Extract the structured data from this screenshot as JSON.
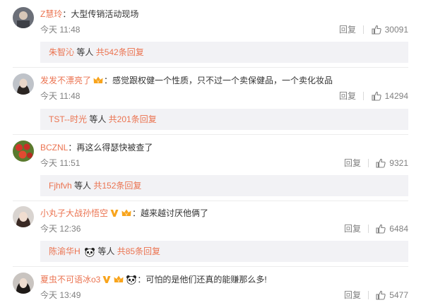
{
  "comments": [
    {
      "user": "Z慧玲",
      "text": "大型传销活动现场",
      "time": "今天 11:48",
      "reply_label": "回复",
      "likes": "30091",
      "sub": {
        "name": "朱智沁",
        "mid": " 等人 ",
        "more": "共542条回复"
      }
    },
    {
      "user": "发发不漂亮了",
      "text": "感觉跟权健一个性质，只不过一个卖保健品，一个卖化妆品",
      "time": "今天 11:48",
      "reply_label": "回复",
      "likes": "14294",
      "sub": {
        "name": "TST--时光",
        "mid": " 等人 ",
        "more": "共201条回复"
      }
    },
    {
      "user": "BCZNL",
      "text": "再这么得瑟快被查了",
      "time": "今天 11:51",
      "reply_label": "回复",
      "likes": "9321",
      "sub": {
        "name": "Fjhfvh",
        "mid": " 等人 ",
        "more": "共152条回复"
      }
    },
    {
      "user": "小丸子大战孙悟空",
      "text": "越来越讨厌他俩了",
      "time": "今天 12:36",
      "reply_label": "回复",
      "likes": "6484",
      "sub": {
        "name": "陈渝华H",
        "mid": " 等人 ",
        "more": "共85条回复"
      }
    },
    {
      "user": "夏虫不可语冰o3",
      "text": "可怕的是他们还真的能赚那么多!",
      "time": "今天 13:49",
      "reply_label": "回复",
      "likes": "5477"
    }
  ],
  "colors": {
    "username": "#eb7350",
    "text": "#333333",
    "meta": "#808080",
    "reply_box": "#f2f2f5",
    "vip_badge": "#f8a41c"
  },
  "icons": {
    "like": "thumbs-up-icon",
    "verified": "yellow-v-icon",
    "membership": "vip-crown-icon",
    "panda": "panda-icon"
  }
}
